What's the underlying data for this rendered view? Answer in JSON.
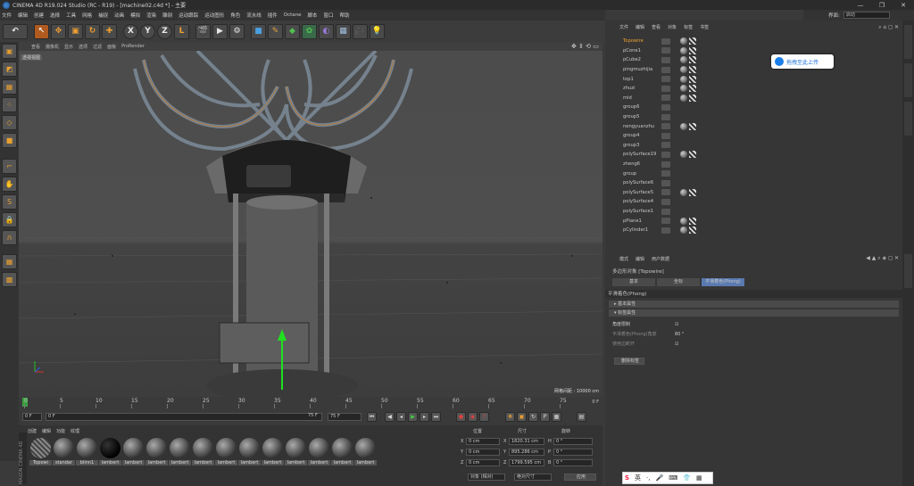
{
  "titlebar": {
    "title": "CINEMA 4D R19.024 Studio (RC - R19) - [machine02.c4d *] - 主要"
  },
  "menubar": [
    "文件",
    "编辑",
    "创建",
    "选择",
    "工具",
    "网格",
    "捕捉",
    "动画",
    "模拟",
    "渲染",
    "雕刻",
    "运动跟踪",
    "运动图形",
    "角色",
    "流水线",
    "插件",
    "Octane",
    "脚本",
    "窗口",
    "帮助"
  ],
  "layout": {
    "label": "界面:",
    "value": "启动"
  },
  "toolbar": {
    "undo_icon": "undo-icon",
    "tools": [
      "live-select-icon",
      "move-icon",
      "scale-icon",
      "rotate-icon",
      "move-plus-icon"
    ],
    "axes": [
      "X",
      "Y",
      "Z"
    ],
    "others": [
      "coordinate-icon",
      "render-view-icon",
      "render-icon",
      "render-settings-icon",
      "cube-icon",
      "pen-icon",
      "subdivide-icon",
      "cloner-icon",
      "deformer-icon",
      "environment-icon",
      "camera-icon",
      "light-icon"
    ]
  },
  "viewport": {
    "menu": [
      "查看",
      "摄像机",
      "显示",
      "选项",
      "过滤",
      "面板",
      "ProRender"
    ],
    "view_label": "透视视图",
    "grid_info": "网格间距 : 10000 cm"
  },
  "timeline": {
    "ticks": [
      0,
      5,
      10,
      15,
      20,
      25,
      30,
      35,
      40,
      45,
      50,
      55,
      60,
      65,
      70,
      75
    ],
    "end_frame": "0 F",
    "start_field": "0 F",
    "current_field": "0 F",
    "max_field": "75 F",
    "end_field": "75 F"
  },
  "materials": {
    "tabs": [
      "创建",
      "编辑",
      "功能",
      "纹理"
    ],
    "items": [
      "Topowi",
      "standar",
      "blinn1",
      "lambert",
      "lambert",
      "lambert",
      "lambert",
      "lambert",
      "lambert",
      "lambert",
      "lambert",
      "lambert",
      "lambert",
      "lambert",
      "lambert"
    ]
  },
  "coords": {
    "headers": [
      "位置",
      "尺寸",
      "旋转"
    ],
    "rows": [
      {
        "axis": "X",
        "pos": "0 cm",
        "size": "1820.31 cm",
        "rot_label": "H",
        "rot": "0 °"
      },
      {
        "axis": "Y",
        "pos": "0 cm",
        "size": "895.286 cm",
        "rot_label": "P",
        "rot": "0 °"
      },
      {
        "axis": "Z",
        "pos": "0 cm",
        "size": "1799.595 cm",
        "rot_label": "B",
        "rot": "0 °"
      }
    ],
    "mode1": "对象 (相对)",
    "mode2": "绝对尺寸",
    "apply": "应用"
  },
  "objects": {
    "menu": [
      "文件",
      "编辑",
      "查看",
      "对象",
      "标签",
      "书签"
    ],
    "rows": [
      {
        "name": "Topowire",
        "tags": "two"
      },
      {
        "name": "pCone1",
        "tags": "two"
      },
      {
        "name": "pCube2",
        "tags": "two"
      },
      {
        "name": "pingmuzhijia",
        "tags": "two"
      },
      {
        "name": "top1",
        "tags": "two"
      },
      {
        "name": "zhuzi",
        "tags": "two"
      },
      {
        "name": "mid",
        "tags": "two"
      },
      {
        "name": "group6",
        "tags": "none"
      },
      {
        "name": "group5",
        "tags": "none"
      },
      {
        "name": "nengyuanzhu",
        "tags": "two"
      },
      {
        "name": "group4",
        "tags": "none"
      },
      {
        "name": "group3",
        "tags": "none"
      },
      {
        "name": "polySurface19",
        "tags": "two"
      },
      {
        "name": "zheng6",
        "tags": "none"
      },
      {
        "name": "group",
        "tags": "none"
      },
      {
        "name": "polySurface6",
        "tags": "none"
      },
      {
        "name": "polySurface5",
        "tags": "two"
      },
      {
        "name": "polySurface4",
        "tags": "none"
      },
      {
        "name": "polySurface1",
        "tags": "none"
      },
      {
        "name": "pPlane1",
        "tags": "two"
      },
      {
        "name": "pCylinder1",
        "tags": "two"
      }
    ]
  },
  "attributes": {
    "menu": [
      "模式",
      "编辑",
      "用户数据"
    ],
    "object_title": "多边形对象 [Topowire]",
    "tabs": [
      "基本",
      "坐标",
      "平滑着色(Phong)"
    ],
    "section": "平滑着色(Phong)",
    "groups": [
      "基本属性",
      "标签属性"
    ],
    "props": [
      {
        "label": "角度限制",
        "value": "☑"
      },
      {
        "label": "平滑着色(Phong)角度",
        "value": "80 °"
      },
      {
        "label": "使用边断开",
        "value": "☑"
      }
    ],
    "delete_button": "删除标签"
  },
  "overlay": {
    "upload_badge": "拖拽至此上传"
  },
  "ime": {
    "items": [
      "S",
      "英",
      "·,",
      "🎤",
      "⌨",
      "👕",
      "▦"
    ]
  }
}
